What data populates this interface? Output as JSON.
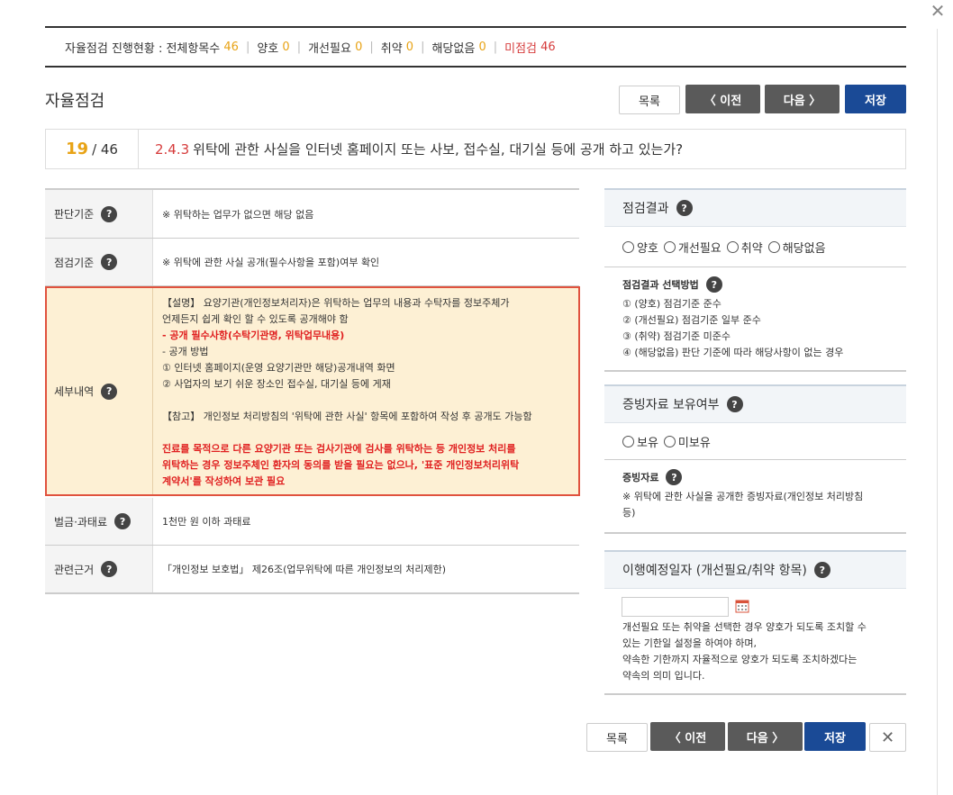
{
  "close_symbol": "✕",
  "progress": {
    "label": "자율점검 진행현황 : 전체항목수",
    "total": "46",
    "good_label": "양호",
    "good": "0",
    "improve_label": "개선필요",
    "improve": "0",
    "weak_label": "취약",
    "weak": "0",
    "na_label": "해당없음",
    "na": "0",
    "unchecked_label": "미점검",
    "unchecked": "46"
  },
  "page_title": "자율점검",
  "buttons": {
    "list": "목록",
    "prev": "〈 이전",
    "next": "다음 〉",
    "save": "저장",
    "close": "✕"
  },
  "question": {
    "current": "19",
    "total": "/ 46",
    "code": "2.4.3",
    "text": "위탁에 관한 사실을 인터넷 홈페이지 또는 사보, 접수실, 대기실 등에 공개 하고 있는가?"
  },
  "table": {
    "criteria_label": "판단기준",
    "criteria_value": "※ 위탁하는 업무가 없으면 해당 없음",
    "check_label": "점검기준",
    "check_value": "※ 위탁에 관한 사실 공개(필수사항을 포함)여부 확인",
    "detail_label": "세부내역",
    "detail_lines": {
      "l1": "【설명】 요양기관(개인정보처리자)은 위탁하는 업무의 내용과 수탁자를 정보주체가",
      "l2": "언제든지 쉽게 확인 할 수 있도록 공개해야 함",
      "l3": "- 공개 필수사항(수탁기관명, 위탁업무내용)",
      "l4": "- 공개 방법",
      "l5": "① 인터넷 홈페이지(운영 요양기관만 해당)공개내역 화면",
      "l6": "② 사업자의 보기 쉬운 장소인 접수실, 대기실 등에 게재",
      "l7": "【참고】 개인정보 처리방침의 '위탁에 관한 사실' 항목에 포함하여 작성 후 공개도 가능함",
      "l8": "진료를 목적으로 다른 요양기관 또는 검사기관에 검사를 위탁하는 등 개인정보 처리를",
      "l9": "위탁하는 경우 정보주체인 환자의 동의를 받을 필요는 없으나, '표준 개인정보처리위탁",
      "l10": "계약서'를 작성하여 보관 필요"
    },
    "penalty_label": "벌금·과태료",
    "penalty_value": "1천만 원 이하 과태료",
    "basis_label": "관련근거",
    "basis_value": "「개인정보 보호법」 제26조(업무위탁에 따른 개인정보의 처리제한)"
  },
  "result": {
    "title": "점검결과",
    "options": [
      "양호",
      "개선필요",
      "취약",
      "해당없음"
    ],
    "method_title": "점검결과 선택방법",
    "method_lines": [
      "① (양호) 점검기준 준수",
      "② (개선필요) 점검기준 일부 준수",
      "③ (취약) 점검기준 미준수",
      "④ (해당없음) 판단 기준에 따라 해당사항이 없는 경우"
    ]
  },
  "evidence": {
    "title": "증빙자료 보유여부",
    "options": [
      "보유",
      "미보유"
    ],
    "sub_title": "증빙자료",
    "sub_line1": "※ 위탁에 관한 사실을 공개한 증빙자료(개인정보 처리방침",
    "sub_line2": "등)"
  },
  "schedule": {
    "title": "이행예정일자 (개선필요/취약 항목)",
    "input_value": "",
    "note_lines": [
      "개선필요 또는 취약을 선택한 경우 양호가 되도록 조치할 수",
      "있는 기한일 설정을 하여야 하며,",
      "약속한 기한까지 자율적으로 양호가 되도록 조치하겠다는",
      "약속의 의미 입니다."
    ]
  },
  "help_symbol": "?",
  "colors": {
    "accent": "#e8a316",
    "danger": "#d63c3c",
    "primary": "#1a4a96",
    "nav": "#5a5a5a"
  }
}
